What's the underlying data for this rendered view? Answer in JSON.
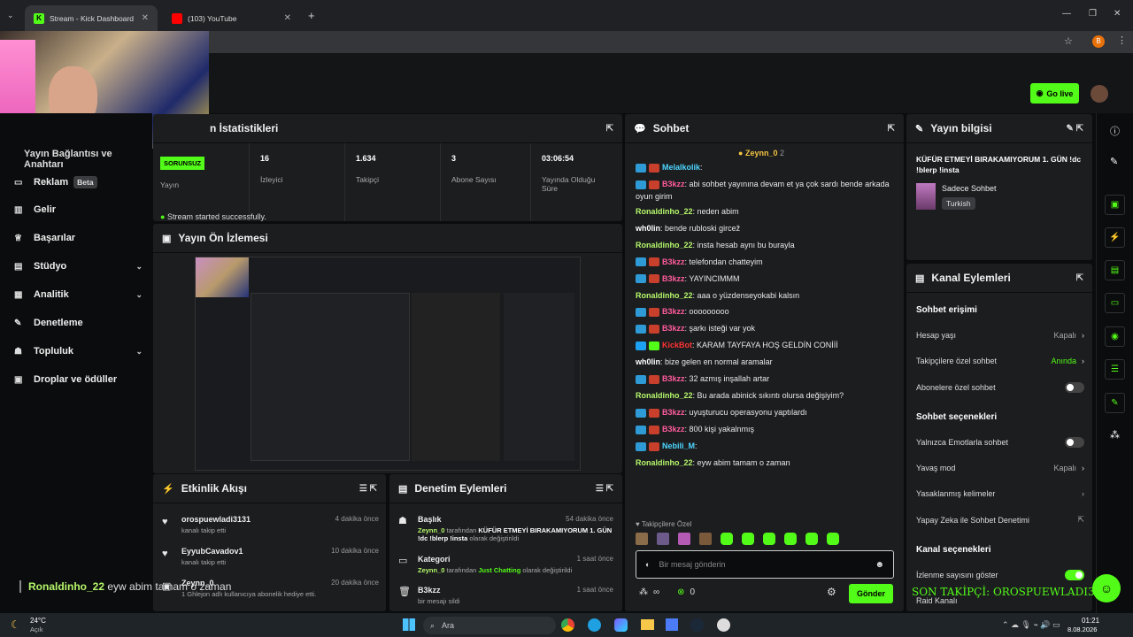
{
  "browser": {
    "tabs": [
      {
        "title": "Stream - Kick Dashboard"
      },
      {
        "title": "(103) YouTube"
      }
    ],
    "profile_initial": "B"
  },
  "header": {
    "go_live": "Go live"
  },
  "sidebar": {
    "section_title": "Yayın Bağlantısı ve Anahtarı",
    "items": [
      {
        "label": "Reklam",
        "badge": "Beta"
      },
      {
        "label": "Gelir"
      },
      {
        "label": "Başarılar"
      },
      {
        "label": "Stüdyo"
      },
      {
        "label": "Analitik"
      },
      {
        "label": "Denetleme"
      },
      {
        "label": "Topluluk"
      },
      {
        "label": "Droplar ve ödüller"
      }
    ]
  },
  "stats": {
    "title": "n İstatistikleri",
    "status_badge": "SORUNSUZ",
    "columns": [
      {
        "value": "",
        "label": "Yayın"
      },
      {
        "value": "16",
        "label": "İzleyici"
      },
      {
        "value": "1.634",
        "label": "Takipçi"
      },
      {
        "value": "3",
        "label": "Abone Sayısı"
      },
      {
        "value": "03:06:54",
        "label": "Yayında Olduğu Süre"
      }
    ],
    "success_msg": "Stream started successfully."
  },
  "preview": {
    "title": "Yayın Ön İzlemesi"
  },
  "activity": {
    "title": "Etkinlik Akışı",
    "items": [
      {
        "name": "orospuewladi3131",
        "time": "4 dakika önce",
        "desc": "kanalı takip etti"
      },
      {
        "name": "EyyubCavadov1",
        "time": "10 dakika önce",
        "desc": "kanalı takip etti"
      },
      {
        "name": "Zeynn_0",
        "time": "20 dakika önce",
        "desc": "1 Ghlejon adlı kullanıcıya abonelik hediye etti."
      }
    ]
  },
  "moderation": {
    "title": "Denetim Eylemleri",
    "items": [
      {
        "name": "Başlık",
        "time": "54 dakika önce",
        "actor": "Zeynn_0",
        "mid": " tarafından ",
        "target": "KÜFÜR ETMEYİ BIRAKAMIYORUM 1. GÜN !dc !blerp !insta",
        "tail": " olarak değiştirildi"
      },
      {
        "name": "Kategori",
        "time": "1 saat önce",
        "actor": "Zeynn_0",
        "mid": " tarafından ",
        "target": "Just Chatting",
        "tail": " olarak değiştirildi"
      },
      {
        "name": "B3kzz",
        "time": "1 saat önce",
        "actor": "",
        "mid": "",
        "target": "",
        "tail": "bir mesajı sildi"
      }
    ]
  },
  "chat": {
    "title": "Sohbet",
    "pinned": {
      "name": "Zeynn_0",
      "count": "2"
    },
    "messages": [
      {
        "user": "Melalkolik",
        "color": "blue",
        "text": ""
      },
      {
        "user": "B3kzz",
        "color": "pink",
        "text": "abi sohbet yayınına devam et ya çok sardı bende arkada oyun girim"
      },
      {
        "user": "Ronaldinho_22",
        "color": "green",
        "text": "neden abim"
      },
      {
        "user": "wh0lin",
        "color": "white",
        "text": "bende rubloski gircež"
      },
      {
        "user": "Ronaldinho_22",
        "color": "green",
        "text": "insta hesab aynı bu burayla"
      },
      {
        "user": "B3kzz",
        "color": "pink",
        "text": "telefondan chatteyim"
      },
      {
        "user": "B3kzz",
        "color": "pink",
        "text": "YAYINCIMMM"
      },
      {
        "user": "Ronaldinho_22",
        "color": "green",
        "text": "aaa o yüzdenseyokabi kalsın"
      },
      {
        "user": "B3kzz",
        "color": "pink",
        "text": "ooooooooo"
      },
      {
        "user": "B3kzz",
        "color": "pink",
        "text": "şarkı isteği var yok"
      },
      {
        "user": "KickBot",
        "color": "red",
        "text": "KARAM TAYFAYA HOŞ GELDİN CONİİİ"
      },
      {
        "user": "wh0lin",
        "color": "white",
        "text": "bize gelen en normal aramalar"
      },
      {
        "user": "B3kzz",
        "color": "pink",
        "text": "32 azmış inşallah artar"
      },
      {
        "user": "Ronaldinho_22",
        "color": "green",
        "text": "Bu arada abinick sıkıntı olursa değişiyim?"
      },
      {
        "user": "B3kzz",
        "color": "pink",
        "text": "uyuşturucu operasyonu yaptılardı"
      },
      {
        "user": "B3kzz",
        "color": "pink",
        "text": "800 kişi yakalnmış"
      },
      {
        "user": "Nebili_M",
        "color": "blue",
        "text": ""
      },
      {
        "user": "Ronaldinho_22",
        "color": "green",
        "text": "eyw abim tamam o zaman"
      }
    ],
    "followers_only": "Takipçilere Özel",
    "input_placeholder": "Bir mesaj gönderin",
    "send": "Gönder",
    "infinity": "∞",
    "points": "0"
  },
  "stream_info": {
    "title": "Yayın bilgisi",
    "stream_title": "KÜFÜR ETMEYİ BIRAKAMIYORUM 1. GÜN !dc !blerp !insta",
    "mode": "Sadece Sohbet",
    "language": "Turkish"
  },
  "channel_actions": {
    "title": "Kanal Eylemleri",
    "chat_access": "Sohbet erişimi",
    "account_age": {
      "label": "Hesap yaşı",
      "value": "Kapalı"
    },
    "followers_chat": {
      "label": "Takipçilere özel sohbet",
      "value": "Anında"
    },
    "subs_chat": {
      "label": "Abonelere özel sohbet"
    },
    "chat_options": "Sohbet seçenekleri",
    "emotes_only": {
      "label": "Yalnızca Emotlarla sohbet"
    },
    "slow_mode": {
      "label": "Yavaş mod",
      "value": "Kapalı"
    },
    "banned_words": {
      "label": "Yasaklanmış kelimeler"
    },
    "ai_mod": {
      "label": "Yapay Zeka ile Sohbet Denetimi"
    },
    "channel_options": "Kanal seçenekleri",
    "view_count": {
      "label": "İzlenme sayısını göster"
    },
    "raid": {
      "label": "Raid Kanalı"
    }
  },
  "overlay": {
    "chat_user": "Ronaldinho_22",
    "chat_text": " eyw abim tamam o zaman",
    "last_follower": "SON TAKİPÇİ: OROSPUEWLADI3131"
  },
  "taskbar": {
    "weather_temp": "24°C",
    "weather_desc": "Açık",
    "search": "Ara",
    "time": "01:21",
    "date": "8.08.2026"
  },
  "colors": {
    "accent": "#53fc18",
    "panel": "#1c1d1f",
    "bg": "#0b0c0d"
  }
}
